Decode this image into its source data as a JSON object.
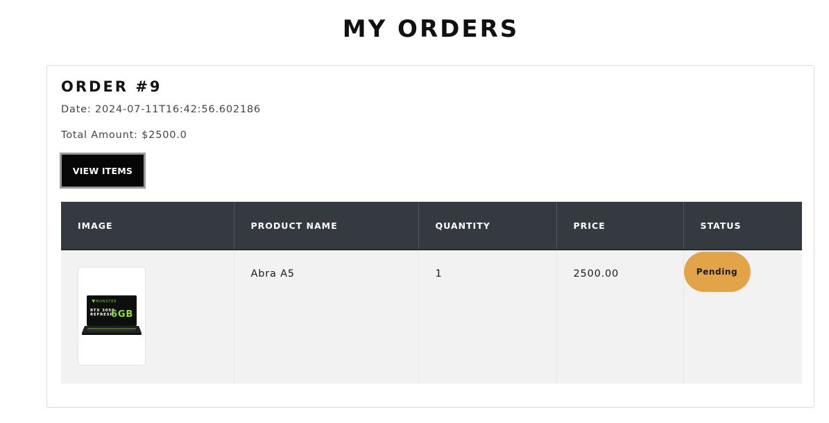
{
  "page": {
    "title": "MY ORDERS"
  },
  "order": {
    "heading": "ORDER #9",
    "date": "Date: 2024-07-11T16:42:56.602186",
    "total": "Total Amount: $2500.0",
    "view_items_label": "VIEW ITEMS"
  },
  "table": {
    "headers": [
      "IMAGE",
      "PRODUCT NAME",
      "QUANTITY",
      "PRICE",
      "STATUS"
    ],
    "rows": [
      {
        "image": "laptop-product-image",
        "image_text": {
          "brand": "MONSTER",
          "line1": "RTX 3050",
          "line2": "REFRESH",
          "badge": "6GB"
        },
        "product_name": "Abra A5",
        "quantity": "1",
        "price": "2500.00",
        "status": "Pending"
      }
    ]
  },
  "colors": {
    "header_bg": "#343a40",
    "row_bg": "#f2f2f2",
    "status_pending": "#e3a447",
    "button_bg": "#060606"
  }
}
